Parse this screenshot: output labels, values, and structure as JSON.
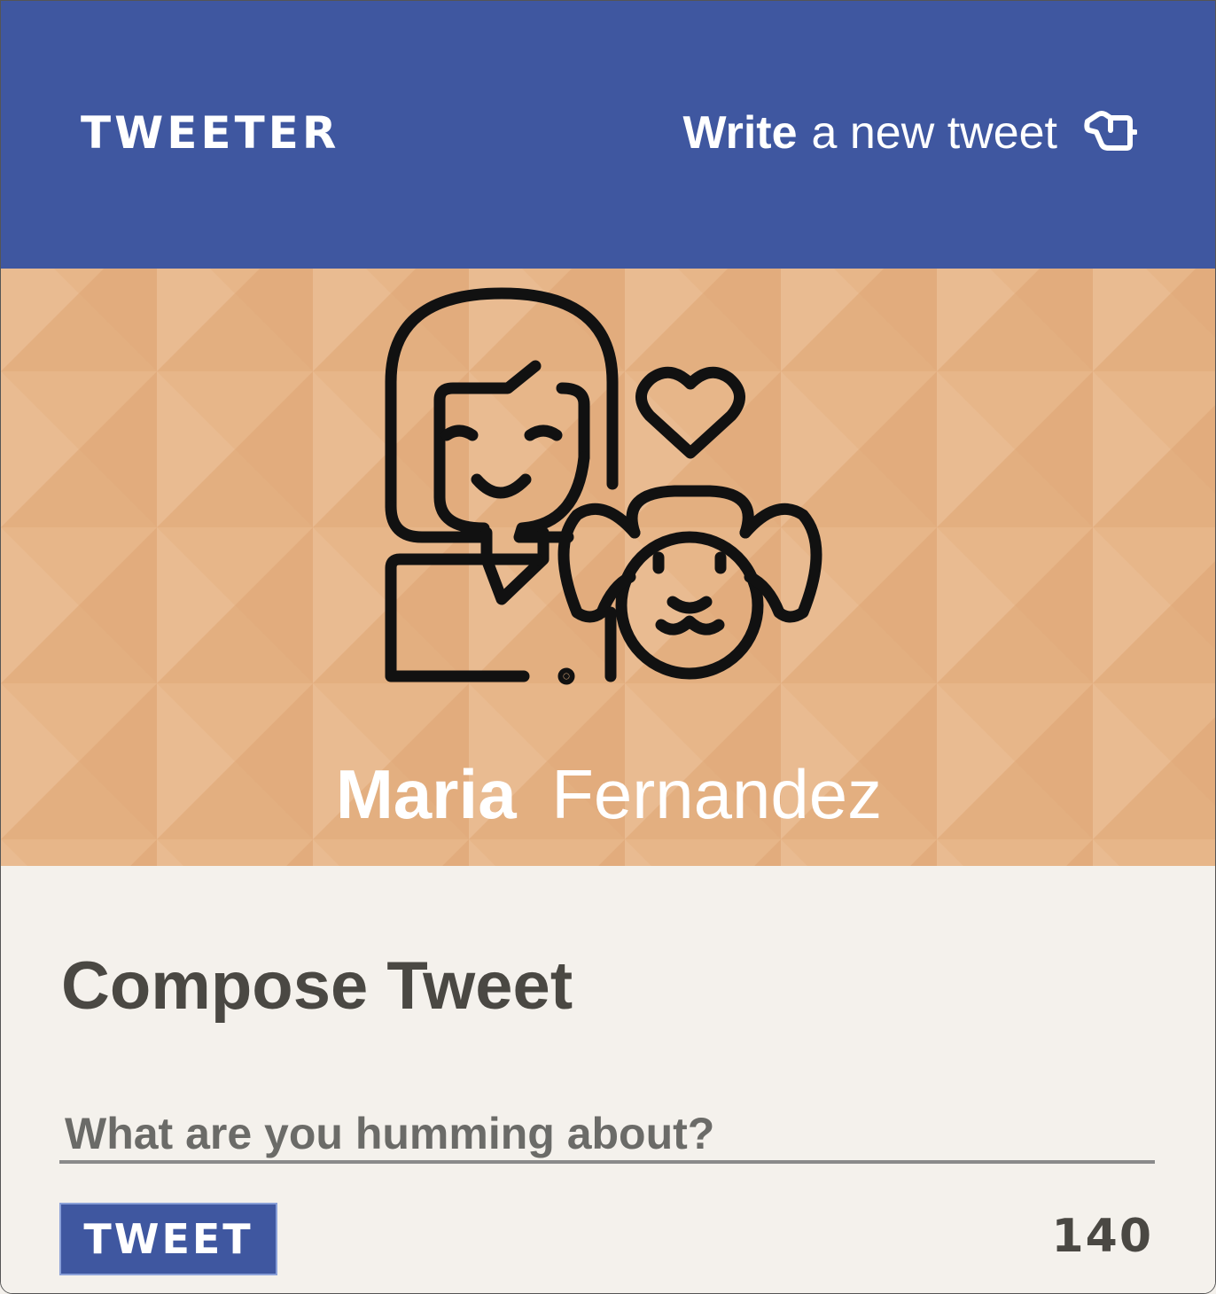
{
  "header": {
    "brand": "TWEETER",
    "write_bold": "Write",
    "write_rest": "a new tweet",
    "write_icon": "pointing-hand-icon",
    "background": "#3f57a0"
  },
  "profile": {
    "first_name": "Maria",
    "last_name": "Fernandez",
    "avatar_icon": "woman-with-dog-avatar",
    "banner_color": "#e5b183"
  },
  "compose": {
    "title": "Compose Tweet",
    "placeholder": "What are you humming about?",
    "button_label": "TWEET",
    "char_count": "140"
  }
}
